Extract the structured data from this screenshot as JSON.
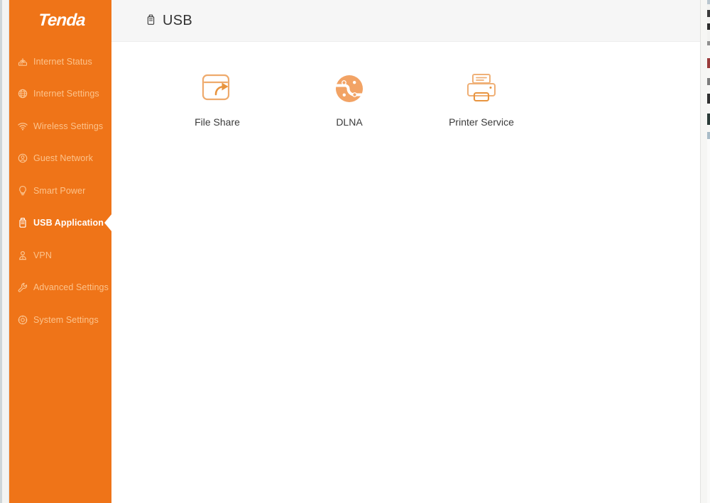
{
  "brand": {
    "name": "Tenda"
  },
  "sidebar": {
    "items": [
      {
        "label": "Internet Status",
        "icon": "router-icon",
        "active": false
      },
      {
        "label": "Internet Settings",
        "icon": "globe-icon",
        "active": false
      },
      {
        "label": "Wireless Settings",
        "icon": "wifi-icon",
        "active": false
      },
      {
        "label": "Guest Network",
        "icon": "guest-shield-icon",
        "active": false
      },
      {
        "label": "Smart Power",
        "icon": "lightbulb-icon",
        "active": false
      },
      {
        "label": "USB Application",
        "icon": "usb-drive-icon",
        "active": true
      },
      {
        "label": "VPN",
        "icon": "vpn-lock-icon",
        "active": false
      },
      {
        "label": "Advanced Settings",
        "icon": "wrench-icon",
        "active": false
      },
      {
        "label": "System Settings",
        "icon": "gear-icon",
        "active": false
      }
    ]
  },
  "header": {
    "title": "USB",
    "icon": "usb-drive-icon"
  },
  "main": {
    "apps": [
      {
        "label": "File Share",
        "icon": "file-share-icon"
      },
      {
        "label": "DLNA",
        "icon": "dlna-icon"
      },
      {
        "label": "Printer Service",
        "icon": "printer-icon"
      }
    ]
  },
  "colors": {
    "brand_orange": "#ef7418",
    "icon_orange": "#f2a365",
    "sidebar_label": "#fcc38c",
    "header_bg": "#f6f6f6",
    "title_text": "#333333"
  }
}
